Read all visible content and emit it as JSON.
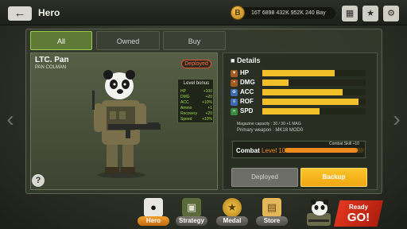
{
  "header": {
    "back_icon": "back-arrow-icon",
    "title": "Hero",
    "currency_icon": "B",
    "currency_text": "16T 6898 432K 952K 240 Bay",
    "icons": [
      "ranking-icon",
      "trophy-icon",
      "settings-gear-icon"
    ]
  },
  "tabs": [
    {
      "label": "All",
      "active": true
    },
    {
      "label": "Owned",
      "active": false
    },
    {
      "label": "Buy",
      "active": false
    }
  ],
  "hero": {
    "rank_name": "LTC. Pan",
    "subtitle": "PAN COLMAN",
    "status": "Deployed",
    "help": "?"
  },
  "level_bonus": {
    "title": "Level bonus",
    "rows": [
      {
        "name": "HP",
        "value": "+100"
      },
      {
        "name": "DMG",
        "value": "+20"
      },
      {
        "name": "ACC",
        "value": "+10%"
      },
      {
        "name": "Ammo",
        "value": "+1"
      },
      {
        "name": "Recovery",
        "value": "+20"
      },
      {
        "name": "Speed",
        "value": "+10%"
      }
    ]
  },
  "details": {
    "title": "Details",
    "stats": [
      {
        "name": "HP",
        "icon": "heart-icon",
        "fill": 0.7
      },
      {
        "name": "DMG",
        "icon": "bullet-icon",
        "fill": 0.25
      },
      {
        "name": "ACC",
        "icon": "crosshair-icon",
        "fill": 0.78
      },
      {
        "name": "ROF",
        "icon": "fire-rate-icon",
        "fill": 0.93
      },
      {
        "name": "SPD",
        "icon": "speed-icon",
        "fill": 0.55
      }
    ],
    "magazine": "Magazine capacity : 30 / 30 +1 MAG",
    "weapon": "Primary weapon : MK18 MOD0",
    "combat_label": "Combat",
    "combat_level": "Level 10",
    "combat_skill": "Combat Skill +10",
    "combat_fill": 0.92
  },
  "actions": {
    "deployed": "Deployed",
    "backup": "Backup"
  },
  "nav": [
    {
      "label": "Hero",
      "icon": "panda-icon",
      "active": true
    },
    {
      "label": "Strategy",
      "icon": "tank-icon",
      "active": false
    },
    {
      "label": "Medal",
      "icon": "medal-icon",
      "active": false
    },
    {
      "label": "Store",
      "icon": "ticket-icon",
      "active": false
    }
  ],
  "ready": {
    "top": "Ready",
    "go": "GO!"
  },
  "colors": {
    "accent_yellow": "#f2c12a",
    "accent_orange": "#ef8a1e",
    "tab_active": "#9acb4c",
    "deployed_red": "#e0522d"
  }
}
